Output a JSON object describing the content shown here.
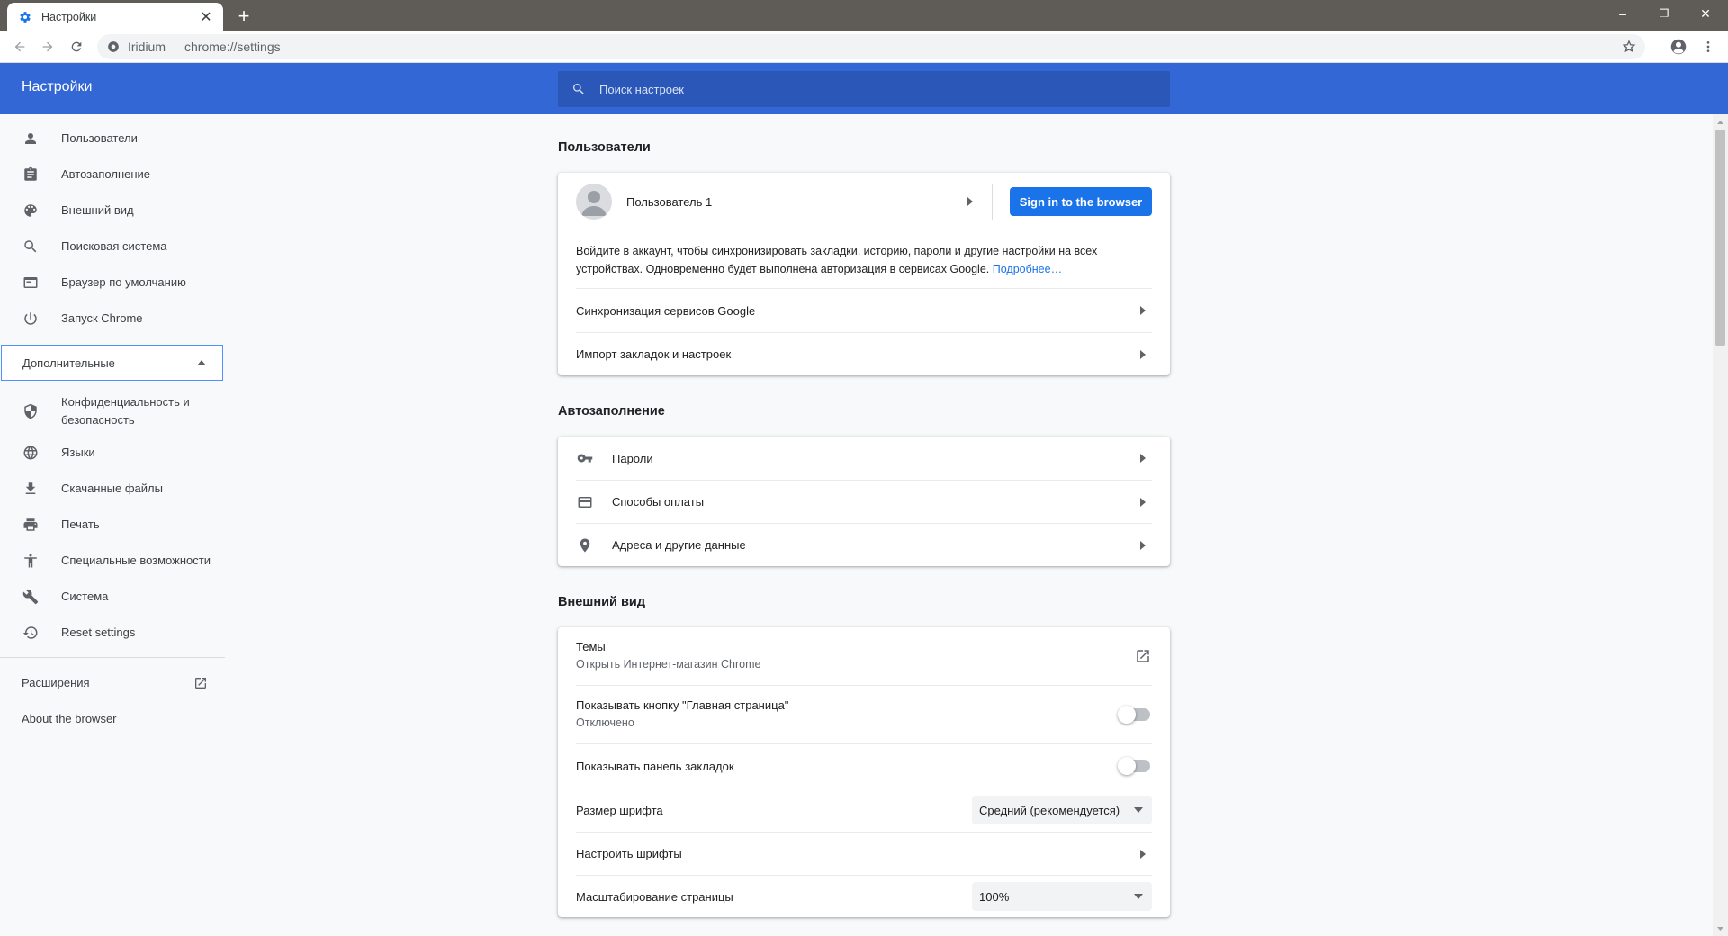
{
  "browser": {
    "tab_title": "Настройки",
    "tab_close": "✕",
    "new_tab": "+",
    "window_controls": {
      "minimize": "–",
      "restore": "❐",
      "close": "✕"
    },
    "omnibox": {
      "site_name": "Iridium",
      "url": "chrome://settings"
    }
  },
  "header": {
    "title": "Настройки",
    "search_placeholder": "Поиск настроек"
  },
  "sidebar": {
    "items": [
      {
        "label": "Пользователи",
        "icon": "person-icon"
      },
      {
        "label": "Автозаполнение",
        "icon": "clipboard-icon"
      },
      {
        "label": "Внешний вид",
        "icon": "palette-icon"
      },
      {
        "label": "Поисковая система",
        "icon": "search-icon"
      },
      {
        "label": "Браузер по умолчанию",
        "icon": "browser-window-icon"
      },
      {
        "label": "Запуск Chrome",
        "icon": "power-icon"
      }
    ],
    "advanced_label": "Дополнительные",
    "advanced_items": [
      {
        "label": "Конфиденциальность и безопасность",
        "icon": "shield-icon"
      },
      {
        "label": "Языки",
        "icon": "globe-icon"
      },
      {
        "label": "Скачанные файлы",
        "icon": "download-icon"
      },
      {
        "label": "Печать",
        "icon": "printer-icon"
      },
      {
        "label": "Специальные возможности",
        "icon": "accessibility-icon"
      },
      {
        "label": "Система",
        "icon": "wrench-icon"
      },
      {
        "label": "Reset settings",
        "icon": "history-icon"
      }
    ],
    "extensions_label": "Расширения",
    "about_label": "About the browser"
  },
  "sections": {
    "users": {
      "title": "Пользователи",
      "profile_name": "Пользователь 1",
      "signin_button": "Sign in to the browser",
      "description": "Войдите в аккаунт, чтобы синхронизировать закладки, историю, пароли и другие настройки на всех устройствах. Одновременно будет выполнена авторизация в сервисах Google.",
      "learn_more": "Подробнее…",
      "sync_label": "Синхронизация сервисов Google",
      "import_label": "Импорт закладок и настроек"
    },
    "autofill": {
      "title": "Автозаполнение",
      "passwords": "Пароли",
      "payments": "Способы оплаты",
      "addresses": "Адреса и другие данные"
    },
    "appearance": {
      "title": "Внешний вид",
      "themes": "Темы",
      "themes_sub": "Открыть Интернет-магазин Chrome",
      "home_button": "Показывать кнопку \"Главная страница\"",
      "home_button_sub": "Отключено",
      "bookmarks_bar": "Показывать панель закладок",
      "font_size": "Размер шрифта",
      "font_size_value": "Средний (рекомендуется)",
      "customize_fonts": "Настроить шрифты",
      "page_zoom": "Масштабирование страницы",
      "page_zoom_value": "100%"
    }
  },
  "colors": {
    "header_blue": "#3367d6",
    "search_bg": "#2a57b8",
    "primary_button": "#1a73e8",
    "tabstrip": "#5f5b57"
  }
}
